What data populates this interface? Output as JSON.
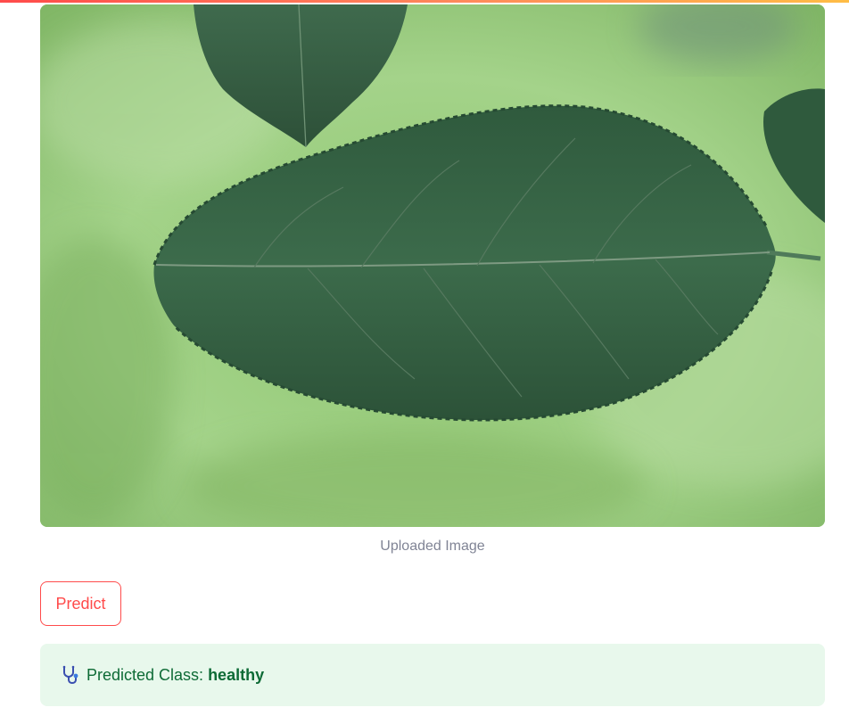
{
  "image": {
    "caption": "Uploaded Image",
    "alt": "leaf photo"
  },
  "predict_button": {
    "label": "Predict"
  },
  "result": {
    "icon": "stethoscope-icon",
    "label": "Predicted Class:",
    "value": "healthy"
  },
  "colors": {
    "accent": "#ff4b4b",
    "success_bg": "#e8f8ec",
    "success_text": "#0e6b36",
    "caption": "#808495"
  }
}
